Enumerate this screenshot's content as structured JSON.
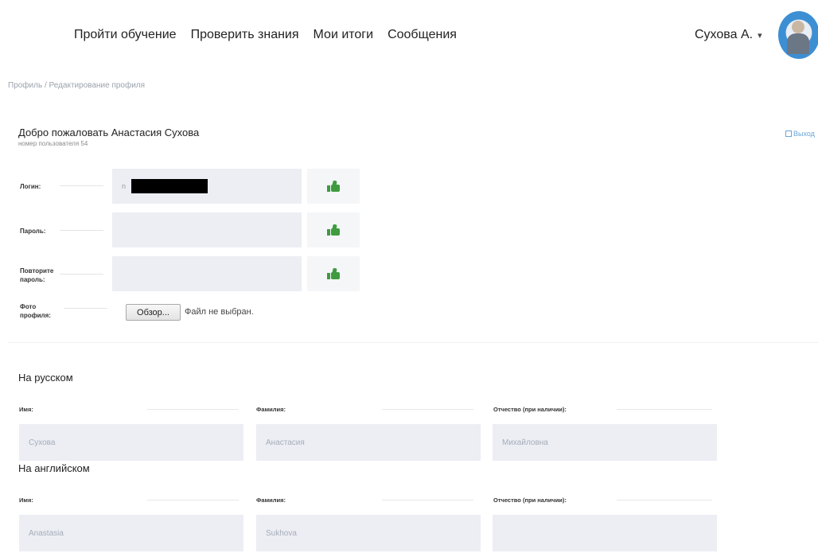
{
  "nav": {
    "items": [
      "Пройти обучение",
      "Проверить знания",
      "Мои итоги",
      "Сообщения"
    ],
    "user_name": "Сухова А.",
    "user_caret": "▾"
  },
  "breadcrumb": "Профиль / Редактирование профиля",
  "welcome": {
    "title": "Добро пожаловать Анастасия Сухова",
    "user_number": "номер пользователя 54",
    "right_link": "Выход"
  },
  "credentials": {
    "login_label": "Логин:",
    "login_prefix": "n",
    "password_label": "Пароль:",
    "repeat_label_1": "Повторите",
    "repeat_label_2": "пароль:",
    "photo_label_1": "Фото",
    "photo_label_2": "профиля:",
    "browse_button": "Обзор...",
    "file_status": "Файл не выбран."
  },
  "russian": {
    "title": "На русском",
    "first_name_label": "Имя:",
    "last_name_label": "Фамилия:",
    "patronymic_label": "Отчество (при наличии):",
    "first_name_value": "Сухова",
    "last_name_value": "Анастасия",
    "patronymic_value": "Михайловна"
  },
  "english": {
    "title": "На английском",
    "first_name_label": "Имя:",
    "last_name_label": "Фамилия:",
    "patronymic_label": "Отчество (при наличии):",
    "first_name_value": "Anastasia",
    "last_name_value": "Sukhova",
    "patronymic_value": ""
  },
  "colors": {
    "accent_green": "#3f9b3f",
    "input_bg": "#eceef4",
    "avatar_blue": "#3d8fd4"
  }
}
